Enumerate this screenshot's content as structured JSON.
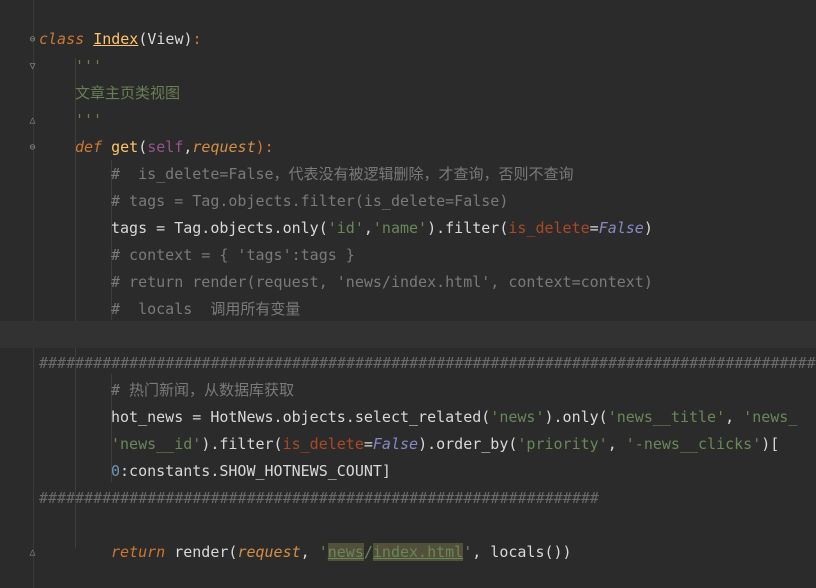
{
  "lines": {
    "l1": {
      "kw": "class",
      "name": "Index",
      "rest": "(View)",
      "colon": ":"
    },
    "l2": "'''",
    "l3": "文章主页类视图",
    "l4": "'''",
    "l5": {
      "kw": "def",
      "fn": "get",
      "open": "(",
      "self": "self",
      "comma": ",",
      "req": "request",
      "close": "):"
    },
    "l6": "#  is_delete=False，代表没有被逻辑删除，才查询，否则不查询",
    "l7": "# tags = Tag.objects.filter(is_delete=False)",
    "l8": {
      "a": "tags = Tag.objects.only(",
      "s1": "'id'",
      "c": ",",
      "s2": "'name'",
      "b": ").filter(",
      "k": "is_delete",
      "eq": "=",
      "f": "False",
      "e": ")"
    },
    "l9": "# context = { 'tags':tags }",
    "l10": "# return render(request, 'news/index.html', context=context)",
    "l11": "#  locals  调用所有变量",
    "l13": "###############################################################################################",
    "l14": "# 热门新闻，从数据库获取",
    "l15": {
      "a": "hot_news = HotNews.objects.select_related(",
      "s1": "'news'",
      "b": ").only(",
      "s2": "'news__title'",
      "c": ", ",
      "s3": "'news_"
    },
    "l16": {
      "s1": "'news__id'",
      "a": ").filter(",
      "k": "is_delete",
      "eq": "=",
      "f": "False",
      "b": ").order_by(",
      "s2": "'priority'",
      "c": ", ",
      "s3": "'-news__clicks'",
      "d": ")["
    },
    "l17": {
      "n": "0",
      "rest": ":constants.SHOW_HOTNEWS_COUNT]"
    },
    "l18": "##############################################################",
    "l20": {
      "kw": "return",
      "a": " render(",
      "req": "request",
      "c": ", ",
      "q1": "'",
      "s1": "news",
      "sl": "/",
      "s2": "index.html",
      "q2": "'",
      "d": ", locals())"
    }
  }
}
